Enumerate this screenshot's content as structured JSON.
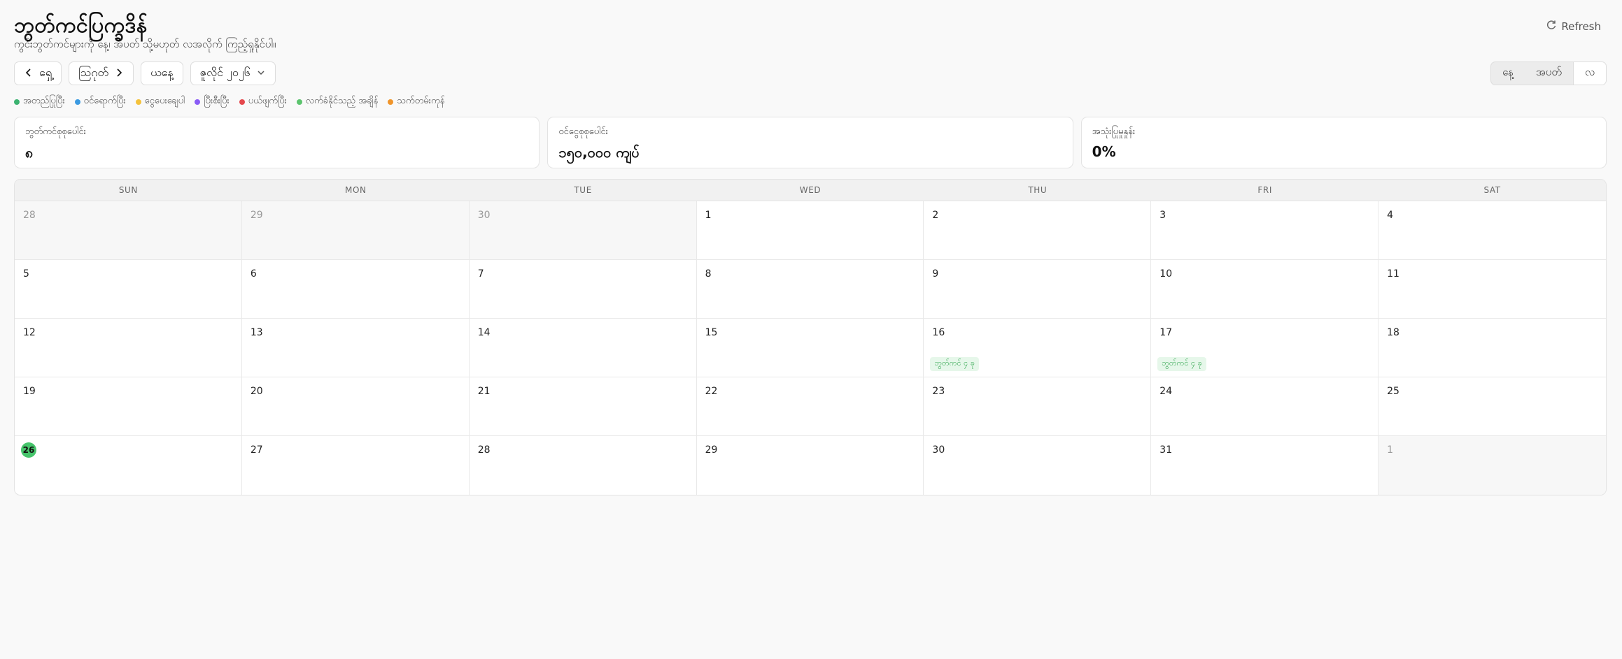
{
  "header": {
    "title": "ဘွတ်ကင်ပြက္ခဒိန်",
    "subtitle": "ကွင်းဘွတ်ကင်များကို နေ့၊ အပတ် သို့မဟုတ် လအလိုက် ကြည့်ရှုနိုင်ပါ။",
    "refresh_label": "Refresh"
  },
  "toolbar": {
    "prev_label": "ရှေ့",
    "next_label": "သြဂုတ်",
    "today_label": "ယနေ့",
    "month_select_value": "ဇူလိုင် ၂၀၂၆"
  },
  "view_toggle": {
    "day": "နေ့",
    "week": "အပတ်",
    "month": "လ",
    "active": "month"
  },
  "legend": [
    {
      "label": "အတည်ပြုပြီး",
      "color": "#3cb371"
    },
    {
      "label": "ဝင်ရောက်ပြီး",
      "color": "#3b9ae1"
    },
    {
      "label": "ငွေပေးချေပါ",
      "color": "#f4c23c"
    },
    {
      "label": "ပြီးစီးပြီး",
      "color": "#8a5cf6"
    },
    {
      "label": "ပယ်ဖျက်ပြီး",
      "color": "#e5484d"
    },
    {
      "label": "လက်ခံနိုင်သည့် အချိန်",
      "color": "#5cc46e"
    },
    {
      "label": "သက်တမ်းကုန်",
      "color": "#f0952b"
    }
  ],
  "stats": [
    {
      "label": "ဘွတ်ကင်စုစုပေါင်း",
      "value": "၈"
    },
    {
      "label": "ဝင်ငွေစုစုပေါင်း",
      "value": "၁၅၀,၀၀၀ ကျပ်"
    },
    {
      "label": "အသုံးပြုမှုနှုန်း",
      "value": "0%"
    }
  ],
  "calendar": {
    "weekdays": [
      "SUN",
      "MON",
      "TUE",
      "WED",
      "THU",
      "FRI",
      "SAT"
    ],
    "days": [
      {
        "n": "28",
        "other": true
      },
      {
        "n": "29",
        "other": true
      },
      {
        "n": "30",
        "other": true
      },
      {
        "n": "1"
      },
      {
        "n": "2"
      },
      {
        "n": "3"
      },
      {
        "n": "4"
      },
      {
        "n": "5"
      },
      {
        "n": "6"
      },
      {
        "n": "7"
      },
      {
        "n": "8"
      },
      {
        "n": "9"
      },
      {
        "n": "10"
      },
      {
        "n": "11"
      },
      {
        "n": "12"
      },
      {
        "n": "13"
      },
      {
        "n": "14"
      },
      {
        "n": "15"
      },
      {
        "n": "16",
        "event": "ဘွတ်ကင် ၄ ခု"
      },
      {
        "n": "17",
        "event": "ဘွတ်ကင် ၄ ခု"
      },
      {
        "n": "18"
      },
      {
        "n": "19"
      },
      {
        "n": "20"
      },
      {
        "n": "21"
      },
      {
        "n": "22"
      },
      {
        "n": "23"
      },
      {
        "n": "24"
      },
      {
        "n": "25"
      },
      {
        "n": "26",
        "today": true
      },
      {
        "n": "27"
      },
      {
        "n": "28"
      },
      {
        "n": "29"
      },
      {
        "n": "30"
      },
      {
        "n": "31"
      },
      {
        "n": "1",
        "other": true
      }
    ]
  }
}
